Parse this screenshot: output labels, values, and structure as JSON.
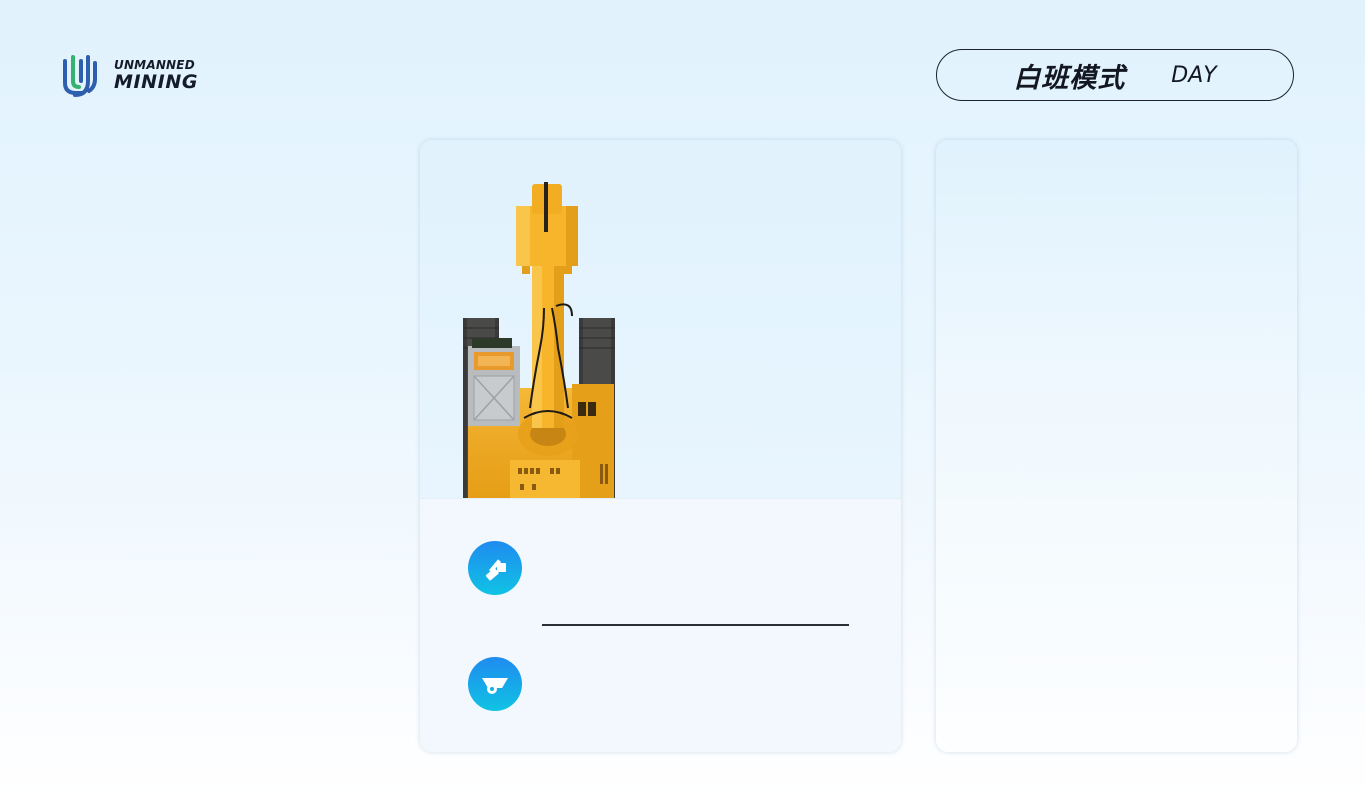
{
  "logo": {
    "line1": "UNMANNED",
    "line2": "MINING",
    "mark_colors": [
      "#2e5fae",
      "#35b36e"
    ]
  },
  "mode": {
    "cn_label": "白班模式",
    "en_label": "DAY"
  },
  "card_main": {
    "image": "yellow-excavator",
    "items": [
      {
        "icon": "excavator-icon"
      },
      {
        "icon": "truck-icon"
      }
    ]
  },
  "colors": {
    "accent_gradient_top": "#1f8bf0",
    "accent_gradient_bottom": "#10c3e4",
    "machine_yellow": "#f5b21d",
    "text_dark": "#141b2a"
  }
}
